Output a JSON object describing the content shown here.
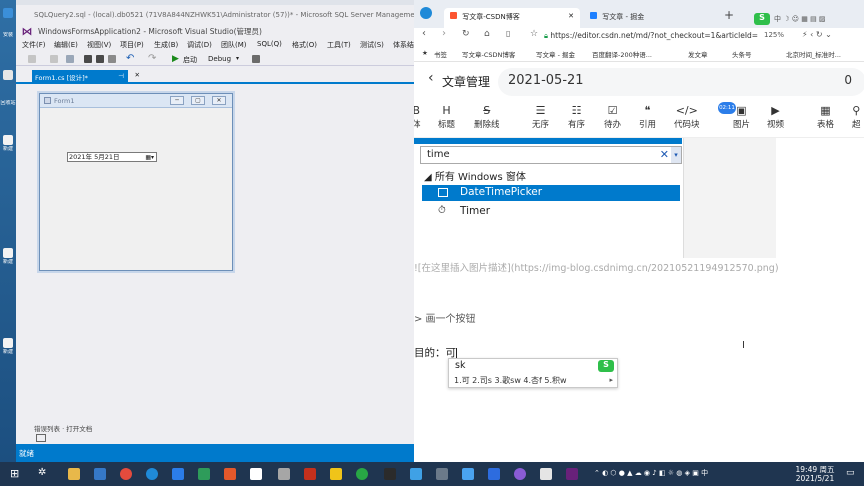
{
  "desktop": {
    "icon_labels": [
      "安装",
      "回收站",
      "新建",
      "新建",
      "新建"
    ]
  },
  "vs": {
    "window_title": "SQLQuery2.sql - (local).db0521 (71V8A844NZHWK51\\Administrator (57))* - Microsoft SQL Server Management S",
    "app_title": "WindowsFormsApplication2 - Microsoft Visual Studio(管理员)",
    "menu": [
      "文件(F)",
      "编辑(E)",
      "视图(V)",
      "项目(P)",
      "生成(B)",
      "调试(D)",
      "团队(M)",
      "SQL(Q)",
      "格式(O)",
      "工具(T)",
      "测试(S)",
      "体系结"
    ],
    "toolbar": {
      "start_label": "启动",
      "config": "Debug"
    },
    "tab_label": "Form1.cs [设计]*",
    "form_title": "Form1",
    "datetimepicker_value": "2021年 5月21日",
    "bottom_tabs": "错误列表 · 打开文档",
    "status": "就绪"
  },
  "browser": {
    "tab_active": "写文章-CSDN博客",
    "tab_2": "写文章 - 掘金",
    "url": "https://editor.csdn.net/md/?not_checkout=1&articleId=",
    "zoom": "125%",
    "bookmarks": [
      "书签",
      "写文章-CSDN博客",
      "写文章 - 掘金",
      "百度翻译-200种语...",
      "发文章",
      "头条号",
      "北京时间_标准时..."
    ],
    "editor": {
      "back_label": "文章管理",
      "title_value": "2021-05-21",
      "word_count": "0",
      "toolbar": [
        {
          "label": "体",
          "icon": "B"
        },
        {
          "label": "标题",
          "icon": "H"
        },
        {
          "label": "删除线",
          "icon": "S"
        },
        {
          "label": "无序",
          "icon": "☰"
        },
        {
          "label": "有序",
          "icon": "☷"
        },
        {
          "label": "待办",
          "icon": "☑"
        },
        {
          "label": "引用",
          "icon": "❝"
        },
        {
          "label": "代码块",
          "icon": "</>"
        },
        {
          "label": "图片",
          "icon": "▣"
        },
        {
          "label": "视频",
          "icon": "▶"
        },
        {
          "label": "表格",
          "icon": "▦"
        },
        {
          "label": "超",
          "icon": "⚲"
        }
      ],
      "timer_badge": "02:11"
    },
    "toolbox": {
      "search_value": "time",
      "section": "所有 Windows 窗体",
      "items": [
        "DateTimePicker",
        "Timer"
      ]
    },
    "md": {
      "link_line": "![在这里插入图片描述](https://img-blog.csdnimg.cn/20210521194912570.png)",
      "quote_line": "> 画一个按钮",
      "text_line": "目的：可"
    },
    "ime": {
      "composition": "sk",
      "candidates": "1.可 2.司s 3.歌sw 4.杏f 5.积w"
    }
  },
  "taskbar": {
    "time": "19:49 周五",
    "date": "2021/5/21"
  },
  "colors": {
    "vs_accent": "#007acc",
    "taskbar": "#1f3550",
    "csdn_red": "#fc5531"
  }
}
